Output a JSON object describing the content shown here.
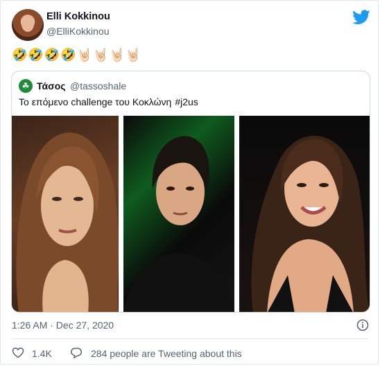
{
  "tweet": {
    "author_name": "Elli Kokkinou",
    "author_handle": "@ElliKokkinou",
    "text": "🤣🤣🤣🤣🤘🏻🤘🏻🤘🏻🤘🏻",
    "timestamp": "1:26 AM · Dec 27, 2020"
  },
  "quote": {
    "author_name": "Τάσος",
    "author_handle": "@tassoshale",
    "avatar_glyph": "☘",
    "text": "Το επόμενο challenge του Κοκλώνη",
    "hashtag": "#j2us"
  },
  "stats": {
    "likes": "1.4K",
    "tweeting": "284 people are Tweeting about this"
  },
  "colors": {
    "twitter_blue": "#1d9bf0",
    "muted_text": "#536471",
    "border": "#cfd9de"
  },
  "icons": {
    "logo": "twitter-bird-icon",
    "info": "info-icon",
    "like": "heart-icon",
    "reply": "speech-bubble-icon"
  }
}
